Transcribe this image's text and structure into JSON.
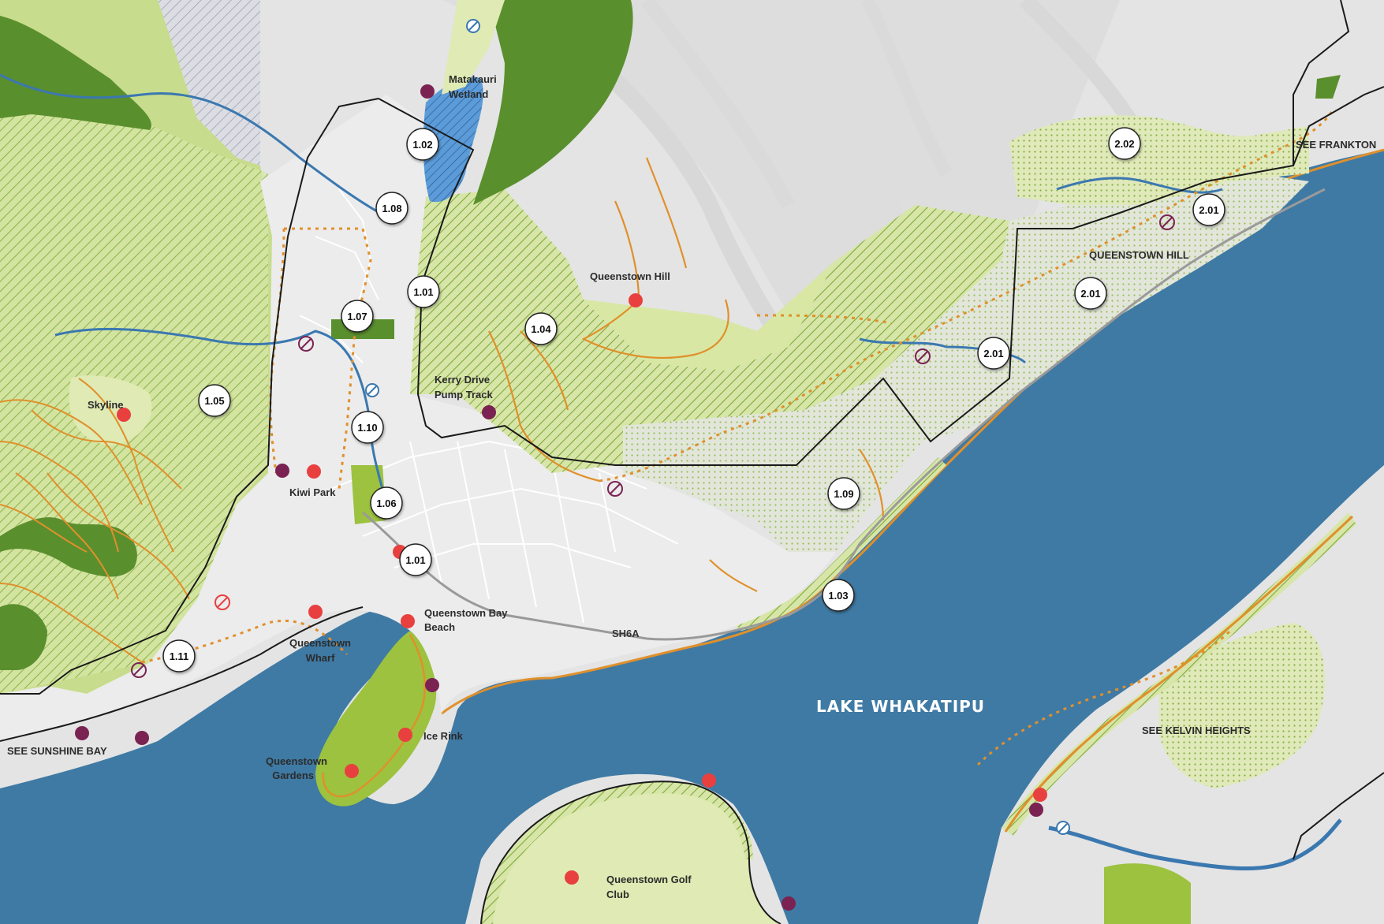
{
  "map": {
    "lake_label": "LAKE WHAKATIPU",
    "road_label": "SH6A",
    "colors": {
      "lake": "#3f7aa4",
      "terrain": "#e4e4e4",
      "reserve_light": "#dfeab4",
      "reserve_mid": "#bcd77a",
      "forest_dark": "#5a8f2e",
      "park_green": "#9cc23f",
      "wetland_blue": "#5b9bd8",
      "trail_orange": "#e0902b",
      "stream_blue": "#3b78b0",
      "boundary_black": "#1a1a1a",
      "poi_red": "#e8403f",
      "poi_purple": "#7a2352"
    },
    "area_markers": [
      "1.02",
      "1.08",
      "1.01",
      "1.07",
      "1.04",
      "1.05",
      "1.10",
      "1.06",
      "1.01",
      "1.11",
      "1.09",
      "1.03",
      "2.02",
      "2.01",
      "2.01",
      "2.01"
    ],
    "place_labels": {
      "matakauri": "Matakauri\nWetland",
      "queenstown_hill_peak": "Queenstown Hill",
      "kerry_drive": "Kerry Drive\nPump Track",
      "skyline": "Skyline",
      "kiwi_park": "Kiwi Park",
      "bay_beach": "Queenstown Bay\nBeach",
      "wharf": "Queenstown\nWharf",
      "ice_rink": "Ice Rink",
      "gardens": "Queenstown\nGardens",
      "golf_club": "Queenstown Golf\nClub",
      "see_sunshine_bay": "SEE SUNSHINE BAY",
      "see_frankton": "SEE FRANKTON",
      "queenstown_hill_area": "QUEENSTOWN HILL",
      "see_kelvin_heights": "SEE KELVIN HEIGHTS"
    },
    "legend_icon_names": [
      "red-poi-icon",
      "purple-poi-icon",
      "no-entry-icon",
      "cycle-crossing-icon"
    ]
  }
}
